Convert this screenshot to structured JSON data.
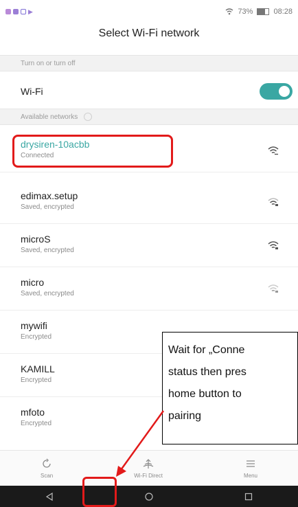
{
  "status_bar": {
    "battery": "73%",
    "time": "08:28"
  },
  "header": {
    "title": "Select Wi-Fi network"
  },
  "sections": {
    "turn_on_off": "Turn on or turn off",
    "available": "Available networks"
  },
  "wifi": {
    "label": "Wi-Fi",
    "enabled": true
  },
  "networks": [
    {
      "name": "drysiren-10acbb",
      "status": "Connected"
    },
    {
      "name": "edimax.setup",
      "status": "Saved, encrypted"
    },
    {
      "name": "microS",
      "status": "Saved, encrypted"
    },
    {
      "name": "micro",
      "status": "Saved, encrypted"
    },
    {
      "name": "mywifi",
      "status": "Encrypted"
    },
    {
      "name": "KAMILL",
      "status": "Encrypted"
    },
    {
      "name": "mfoto",
      "status": "Encrypted"
    }
  ],
  "bottom_tabs": [
    {
      "label": "Scan",
      "icon": "refresh-icon"
    },
    {
      "label": "Wi-Fi Direct",
      "icon": "wifi-direct-icon"
    },
    {
      "label": "Menu",
      "icon": "menu-icon"
    }
  ],
  "callout": {
    "lines": [
      "Wait for „Conne",
      "status then pres",
      "home button to",
      "pairing"
    ]
  },
  "colors": {
    "accent": "#3aa7a3",
    "annotation": "#e21a1a"
  }
}
